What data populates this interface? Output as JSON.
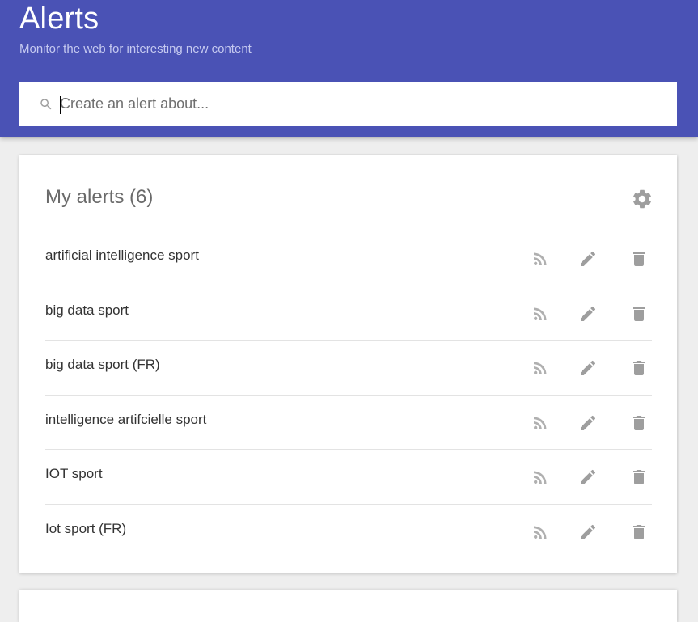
{
  "header": {
    "title": "Alerts",
    "subtitle": "Monitor the web for interesting new content",
    "background_color": "#4a52b5"
  },
  "search": {
    "placeholder": "Create an alert about...",
    "value": "",
    "icon": "search-icon"
  },
  "my_alerts": {
    "title": "My alerts",
    "count": "(6)",
    "settings_icon": "gear-icon",
    "items": [
      {
        "label": "artificial intelligence sport",
        "icons": [
          "rss-icon",
          "pencil-icon",
          "trash-icon"
        ]
      },
      {
        "label": "big data sport",
        "icons": [
          "rss-icon",
          "pencil-icon",
          "trash-icon"
        ]
      },
      {
        "label": "big data sport (FR)",
        "icons": [
          "rss-icon",
          "pencil-icon",
          "trash-icon"
        ]
      },
      {
        "label": "intelligence artifcielle sport",
        "icons": [
          "rss-icon",
          "pencil-icon",
          "trash-icon"
        ]
      },
      {
        "label": "IOT sport",
        "icons": [
          "rss-icon",
          "pencil-icon",
          "trash-icon"
        ]
      },
      {
        "label": "Iot sport (FR)",
        "icons": [
          "rss-icon",
          "pencil-icon",
          "trash-icon"
        ]
      }
    ]
  }
}
